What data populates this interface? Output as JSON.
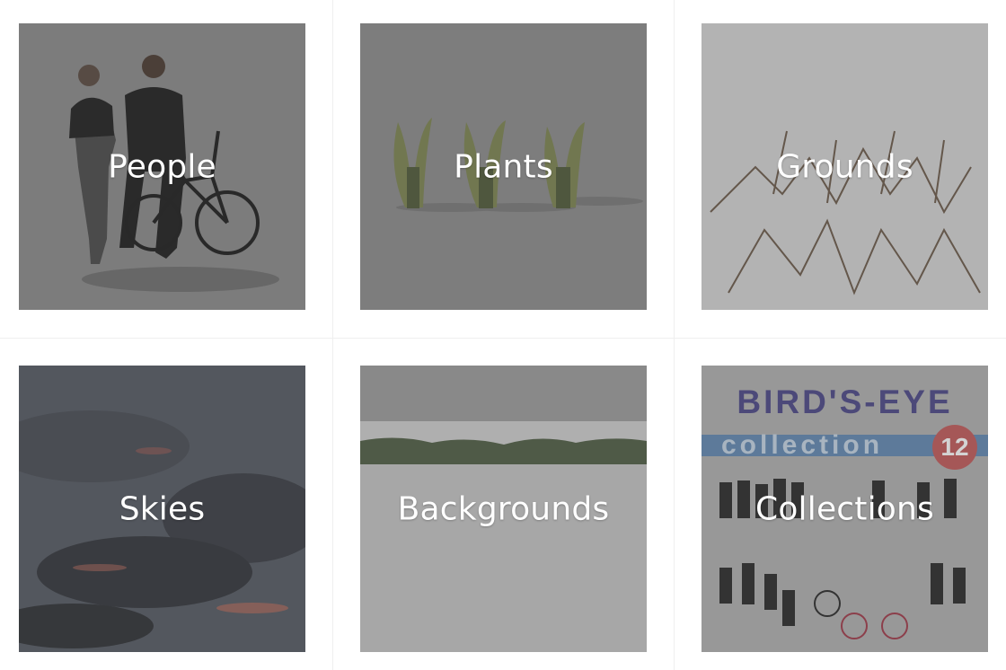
{
  "categories": {
    "people": "People",
    "plants": "Plants",
    "grounds": "Grounds",
    "skies": "Skies",
    "backgrounds": "Backgrounds",
    "collections": "Collections"
  },
  "poster": {
    "title": "BIRD'S-EYE",
    "subtitle": "collection",
    "number": "12"
  },
  "colors": {
    "label_text": "#ffffff",
    "tile_shade": "#808080",
    "poster_title": "#3a3580",
    "poster_band": "#4f7fb4",
    "poster_badge": "#c25a5a"
  }
}
